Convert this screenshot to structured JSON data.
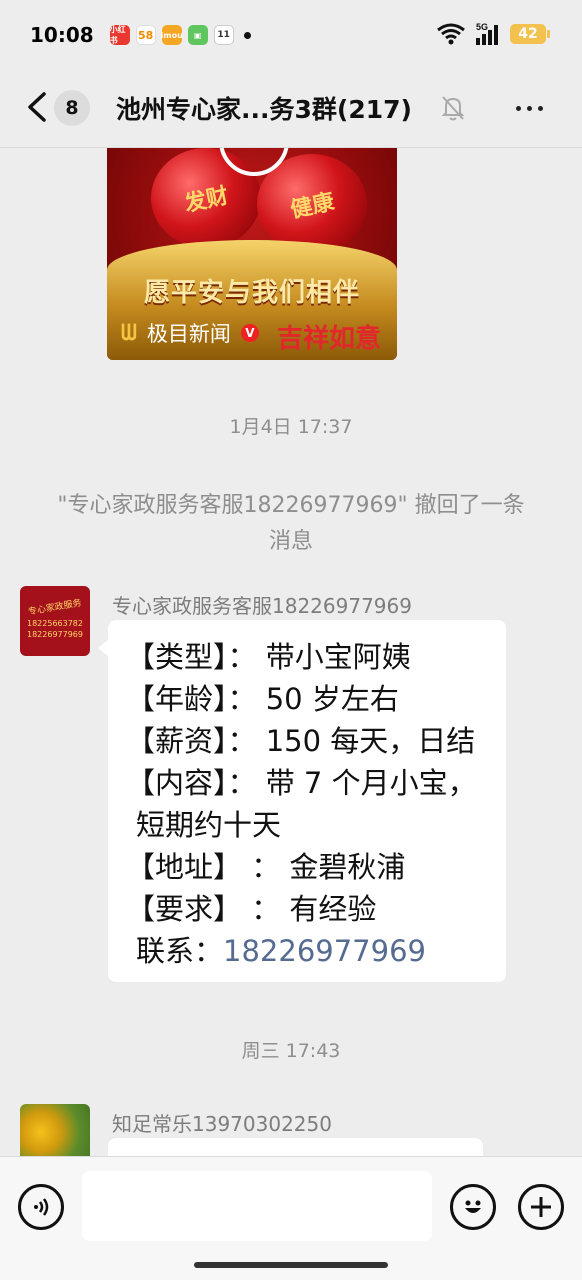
{
  "status_bar": {
    "time": "10:08",
    "notification_icons": [
      "小红书",
      "58",
      "imou",
      "wechat-green",
      "calendar-11"
    ],
    "calendar_day": "11",
    "battery": "42",
    "network": "5G"
  },
  "header": {
    "unread_count": "8",
    "title": "池州专心家...务3群(217)"
  },
  "video_card": {
    "apple_left_text": "发财",
    "apple_right_text": "健康",
    "banner_text": "愿平安与我们相伴",
    "source_name": "极目新闻",
    "verified_badge": "V",
    "deco_text": "吉祥如意"
  },
  "timestamps": {
    "first": "1月4日 17:37",
    "second": "周三 17:43"
  },
  "recall_notice": "\"专心家政服务客服18226977969\" 撤回了一条消息",
  "message1": {
    "sender": "专心家政服务客服18226977969",
    "avatar_title": "专心家政服务",
    "avatar_phone1": "18225663782",
    "avatar_phone2": "18226977969",
    "lines": [
      "【类型】：  带小宝阿姨",
      "【年龄】：  50 岁左右",
      "【薪资】：  150 每天，日结",
      "【内容】：  带 7 个月小宝，",
      "短期约十天",
      "【地址】  ：  金碧秋浦",
      "【要求】  ：  有经验"
    ],
    "contact_label": "联系：",
    "contact_phone": "18226977969"
  },
  "message2": {
    "sender": "知足常乐13970302250"
  },
  "colors": {
    "background": "#EDEDED",
    "link": "#566B92",
    "timestamp": "#8E8E8E"
  }
}
